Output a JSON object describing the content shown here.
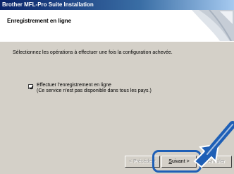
{
  "window": {
    "title": "Brother MFL-Pro Suite Installation"
  },
  "header": {
    "title": "Enregistrement en ligne"
  },
  "main": {
    "instruction": "Sélectionnez les opérations à effectuer une fois la configuration achevée.",
    "checkbox": {
      "checked": true,
      "label_line1": "Effectuer l'enregistrement en ligne",
      "label_line2": "(Ce service n'est pas disponible dans tous les pays.)"
    }
  },
  "buttons": {
    "previous": "< Précédent",
    "next_prefix": "",
    "next_mnemonic": "S",
    "next_rest": "uivant >",
    "cancel": "Annuler"
  },
  "colors": {
    "highlight": "#1e5fb6",
    "title_start": "#0a246a"
  },
  "icons": [
    "checkmark-icon",
    "pointer-arrow-icon",
    "header-graphic"
  ]
}
